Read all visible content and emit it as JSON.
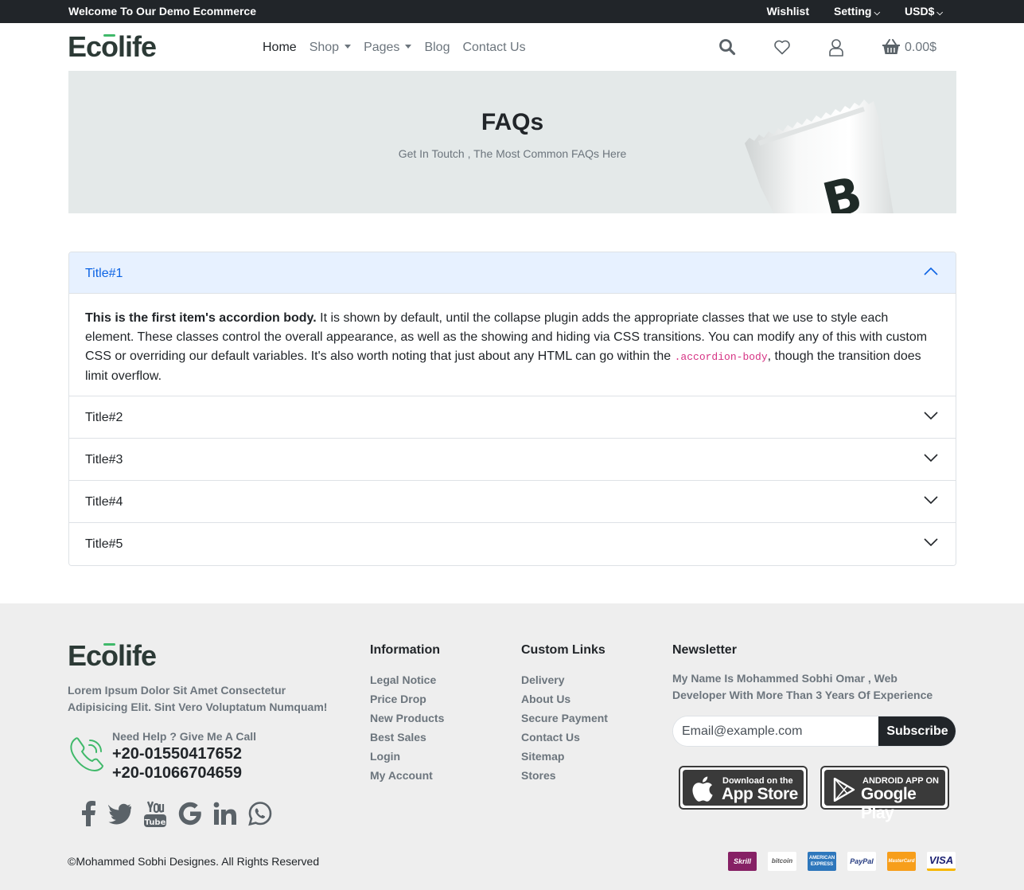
{
  "topbar": {
    "welcome": "Welcome To Our Demo Ecommerce",
    "wishlist": "Wishlist",
    "setting": "Setting",
    "currency": "USD$"
  },
  "header": {
    "logo_pre": "Ec",
    "logo_o": "o",
    "logo_post": "life",
    "nav": [
      "Home",
      "Shop",
      "Pages",
      "Blog",
      "Contact Us"
    ],
    "cart_total": "0.00$"
  },
  "banner": {
    "title": "FAQs",
    "subtitle": "Get In Toutch , The Most Common FAQs Here",
    "pack_letter": "B"
  },
  "accordion": {
    "items": [
      {
        "title": "Title#1",
        "open": true
      },
      {
        "title": "Title#2",
        "open": false
      },
      {
        "title": "Title#3",
        "open": false
      },
      {
        "title": "Title#4",
        "open": false
      },
      {
        "title": "Title#5",
        "open": false
      }
    ],
    "body_strong": "This is the first item's accordion body.",
    "body_text": " It is shown by default, until the collapse plugin adds the appropriate classes that we use to style each element. These classes control the overall appearance, as well as the showing and hiding via CSS transitions. You can modify any of this with custom CSS or overriding our default variables. It's also worth noting that just about any HTML can go within the ",
    "body_code": ".accordion-body",
    "body_tail": ", though the transition does limit overflow."
  },
  "footer": {
    "description": "Lorem Ipsum Dolor Sit Amet Consectetur Adipisicing Elit. Sint Vero Voluptatum Numquam!",
    "help_label": "Need Help ? Give Me A Call",
    "phone_1": "+20-01550417652",
    "phone_2": "+20-01066704659",
    "socials": [
      "facebook-icon",
      "twitter-icon",
      "youtube-icon",
      "google-icon",
      "linkedin-icon",
      "whatsapp-icon"
    ],
    "info_title": "Information",
    "info_links": [
      "Legal Notice",
      "Price Drop",
      "New Products",
      "Best Sales",
      "Login",
      "My Account"
    ],
    "custom_title": "Custom Links",
    "custom_links": [
      "Delivery",
      "About Us",
      "Secure Payment",
      "Contact Us",
      "Sitemap",
      "Stores"
    ],
    "newsletter_title": "Newsletter",
    "newsletter_text": "My Name Is Mohammed Sobhi Omar , Web Developer With More Than 3 Years Of Experience",
    "email_placeholder": "Email@example.com",
    "subscribe": "Subscribe",
    "appstore_small": "Download on the",
    "appstore_big": "App Store",
    "googleplay_small": "ANDROID APP ON",
    "googleplay_big": "Google Play",
    "copyright": "©Mohammed Sobhi Designes. All Rights Reserved",
    "payments": [
      "Skrill",
      "bitcoin",
      "AMERICAN EXPRESS",
      "PayPal",
      "MasterCard",
      "VISA"
    ]
  },
  "colors": {
    "brand_green": "#40b96a",
    "dark": "#212529",
    "accordion_active_bg": "#e7f1ff",
    "accordion_active_text": "#0c63e4",
    "footer_bg": "#eeeeee"
  }
}
